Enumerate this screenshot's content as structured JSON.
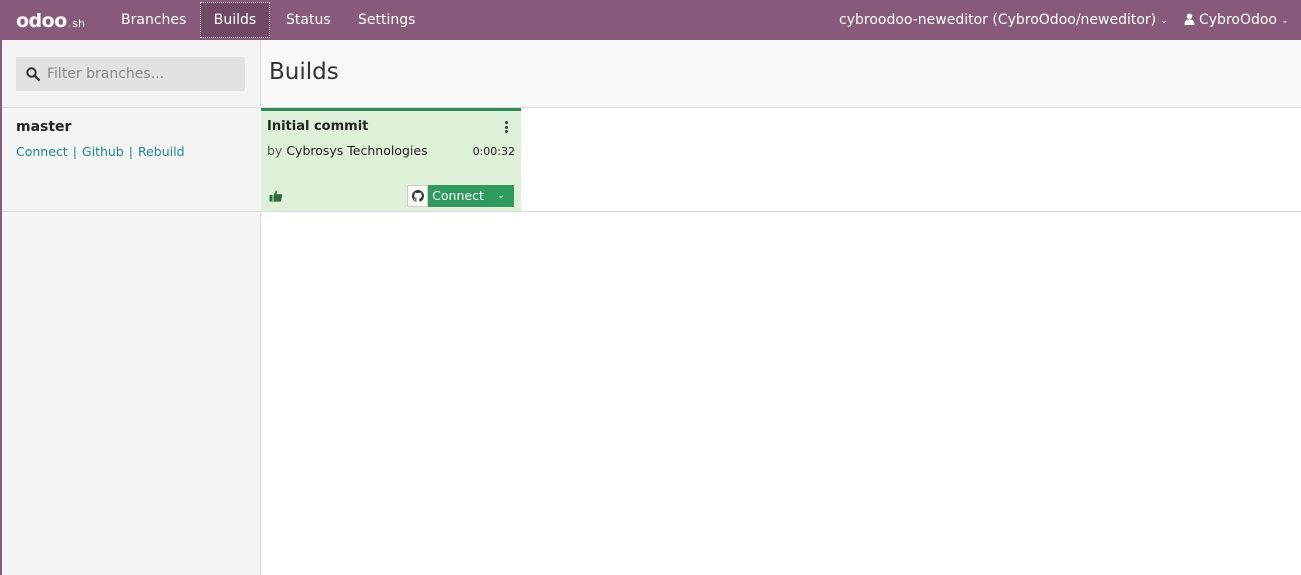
{
  "brand": {
    "logo_main": "odoo",
    "logo_suffix": "sh",
    "color": "#875a7b"
  },
  "nav": {
    "items": [
      {
        "label": "Branches"
      },
      {
        "label": "Builds"
      },
      {
        "label": "Status"
      },
      {
        "label": "Settings"
      }
    ],
    "active": "Builds",
    "project_label": "cybroodoo-neweditor (CybroOdoo/neweditor)",
    "user_label": "CybroOdoo",
    "chevron": "⌄"
  },
  "sidebar": {
    "search_placeholder": "Filter branches...",
    "branches": [
      {
        "name": "master",
        "links": [
          "Connect",
          "Github",
          "Rebuild"
        ]
      }
    ]
  },
  "main": {
    "title": "Builds",
    "builds": [
      {
        "commit": "Initial commit",
        "author_prefix": "by",
        "author": "Cybrosys Technologies",
        "duration": "0:00:32",
        "status_icon": "thumbs-up-icon",
        "status_color": "#2e8b57",
        "connect_label": "Connect",
        "dropdown_glyph": "⌄"
      }
    ]
  }
}
